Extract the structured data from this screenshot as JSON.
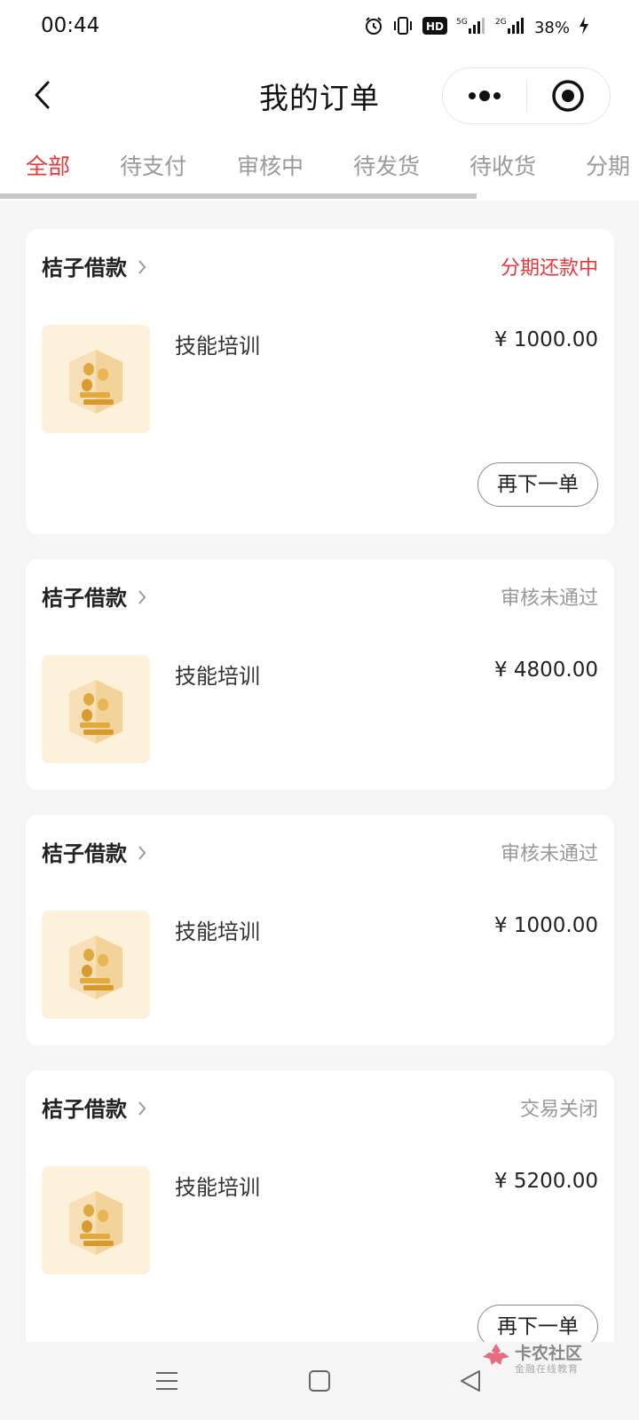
{
  "status_bar": {
    "time": "00:44",
    "network_label": "5G",
    "network2_label": "2G",
    "battery": "38%",
    "icons": [
      "alarm-icon",
      "vibrate-icon",
      "hd-icon",
      "signal-5g-icon",
      "signal-2g-icon",
      "charging-icon"
    ]
  },
  "header": {
    "title": "我的订单",
    "back_icon": "chevron-left-icon",
    "more_icon": "more-dots-icon",
    "close_icon": "target-close-icon"
  },
  "tabs": [
    {
      "label": "全部",
      "active": true
    },
    {
      "label": "待支付",
      "active": false
    },
    {
      "label": "审核中",
      "active": false
    },
    {
      "label": "待发货",
      "active": false
    },
    {
      "label": "待收货",
      "active": false
    },
    {
      "label": "分期",
      "active": false
    }
  ],
  "orders": [
    {
      "shop": "桔子借款",
      "status": "分期还款中",
      "status_color": "#e5383b",
      "product": "技能培训",
      "price": "¥ 1000.00",
      "action": "再下一单"
    },
    {
      "shop": "桔子借款",
      "status": "审核未通过",
      "status_color": "#999999",
      "product": "技能培训",
      "price": "¥ 4800.00",
      "action": ""
    },
    {
      "shop": "桔子借款",
      "status": "审核未通过",
      "status_color": "#999999",
      "product": "技能培训",
      "price": "¥ 1000.00",
      "action": ""
    },
    {
      "shop": "桔子借款",
      "status": "交易关闭",
      "status_color": "#999999",
      "product": "技能培训",
      "price": "¥ 5200.00",
      "action": "再下一单"
    }
  ],
  "nav": {
    "icons": [
      "menu-icon",
      "home-square-icon",
      "back-triangle-icon"
    ]
  },
  "watermark": {
    "main": "卡农社区",
    "sub": "金融在线教育"
  },
  "colors": {
    "accent": "#e5383b",
    "muted": "#999999",
    "background": "#f5f5f5"
  }
}
